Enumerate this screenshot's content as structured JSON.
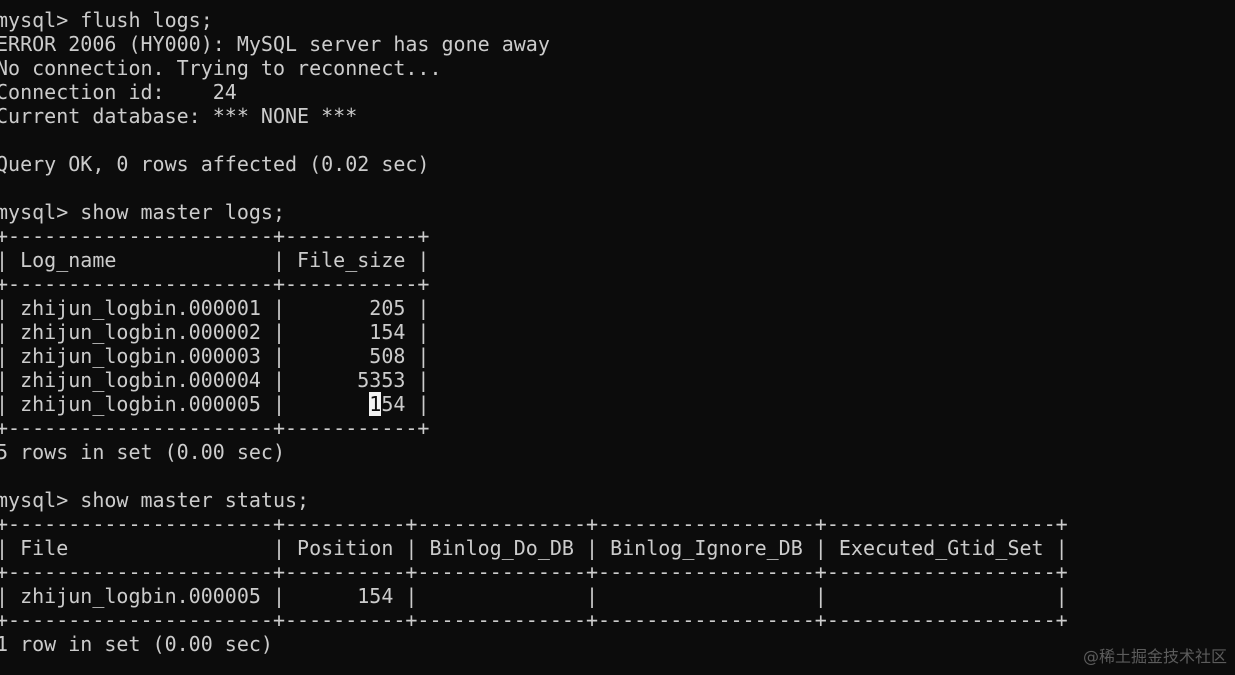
{
  "terminal": {
    "lines": [
      "mysql> flush logs;",
      "ERROR 2006 (HY000): MySQL server has gone away",
      "No connection. Trying to reconnect...",
      "Connection id:    24",
      "Current database: *** NONE ***",
      "",
      "Query OK, 0 rows affected (0.02 sec)",
      "",
      "mysql> show master logs;",
      "+----------------------+-----------+",
      "| Log_name             | File_size |",
      "+----------------------+-----------+",
      "| zhijun_logbin.000001 |       205 |",
      "| zhijun_logbin.000002 |       154 |",
      "| zhijun_logbin.000003 |       508 |",
      "| zhijun_logbin.000004 |      5353 |",
      "| zhijun_logbin.000005 |       154 |",
      "+----------------------+-----------+",
      "5 rows in set (0.00 sec)",
      "",
      "mysql> show master status;",
      "+----------------------+----------+--------------+------------------+-------------------+",
      "| File                 | Position | Binlog_Do_DB | Binlog_Ignore_DB | Executed_Gtid_Set |",
      "+----------------------+----------+--------------+------------------+-------------------+",
      "| zhijun_logbin.000005 |      154 |              |                  |                   |",
      "+----------------------+----------+--------------+------------------+-------------------+",
      "1 row in set (0.00 sec)"
    ],
    "cursor_line_index": 16,
    "cursor_char_index": 31
  },
  "watermark": "@稀土掘金技术社区"
}
